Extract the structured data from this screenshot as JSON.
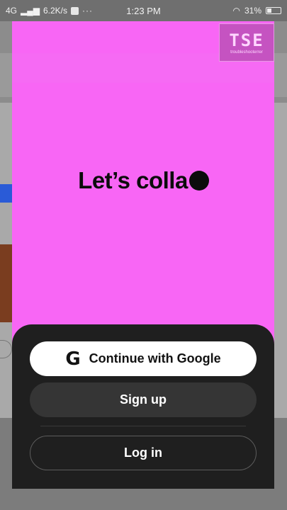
{
  "status_bar": {
    "network": "4G",
    "speed": "6.2K/s",
    "more": "···",
    "time": "1:23 PM",
    "battery": "31%"
  },
  "hero": {
    "text": "Let’s colla"
  },
  "watermark": {
    "big": "TSE",
    "small": "troubleshooterrer"
  },
  "auth": {
    "google_label": "Continue with Google",
    "google_icon": "G",
    "signup_label": "Sign up",
    "login_label": "Log in"
  },
  "colors": {
    "accent": "#f866f5",
    "sheet": "#1f1f1f"
  }
}
